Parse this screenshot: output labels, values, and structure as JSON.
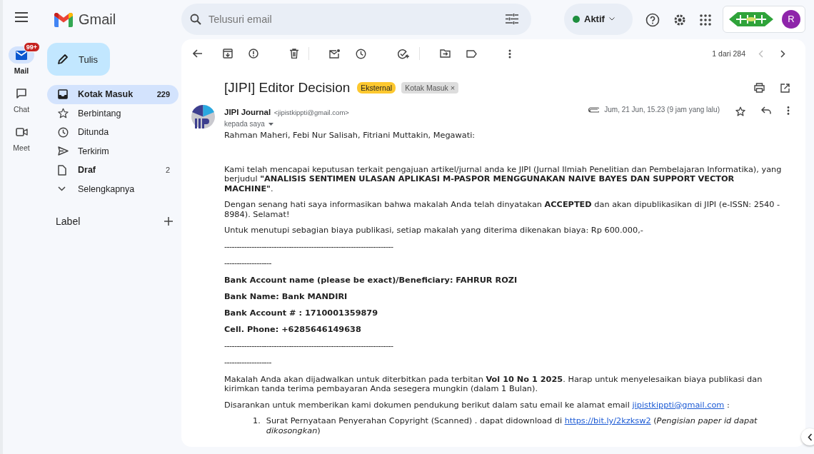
{
  "app_rail": [
    {
      "label": "Mail",
      "selected": true,
      "badge": "99+"
    },
    {
      "label": "Chat",
      "selected": false
    },
    {
      "label": "Meet",
      "selected": false
    }
  ],
  "brand": "Gmail",
  "compose": "Tulis",
  "folders": [
    {
      "label": "Kotak Masuk",
      "count": "229",
      "selected": true,
      "unread": true
    },
    {
      "label": "Berbintang",
      "selected": false,
      "unread": false
    },
    {
      "label": "Ditunda",
      "selected": false,
      "unread": false
    },
    {
      "label": "Terkirim",
      "selected": false,
      "unread": false
    },
    {
      "label": "Draf",
      "count": "2",
      "selected": false,
      "unread": true
    },
    {
      "label": "Selengkapnya",
      "selected": false,
      "unread": false
    }
  ],
  "labels_heading": "Label",
  "search": {
    "placeholder": "Telusuri email"
  },
  "status": {
    "label": "Aktif",
    "color": "#1e8e3e"
  },
  "account": {
    "initial": "R"
  },
  "pagination": "1 dari 284",
  "subject": "[JIPI] Editor Decision",
  "tags": [
    {
      "label": "Eksternal",
      "kind": "external"
    },
    {
      "label": "Kotak Masuk",
      "kind": "folder",
      "close": "×"
    }
  ],
  "message": {
    "sender": "JIPI Journal",
    "address": "<jipistkippti@gmail.com>",
    "to": "kepada saya",
    "date": "Jum, 21 Jun, 15.23 (9 jam yang lalu)",
    "body": [
      {
        "kind": "greeting",
        "text": "Rahman Maheri, Febi Nur Salisah, Fitriani Muttakin, Megawati:"
      },
      {
        "kind": "text",
        "text": "Kami telah mencapai keputusan terkait pengajuan artikel/jurnal anda ke JIPI (Jurnal Ilmiah Penelitian dan Pembelajaran Informatika), yang berjudul **\"ANALISIS SENTIMEN ULASAN APLIKASI M-PASPOR MENGGUNAKAN NAIVE BAYES DAN SUPPORT VECTOR MACHINE\"**."
      },
      {
        "kind": "text",
        "text": "Dengan senang hati saya informasikan bahwa makalah Anda telah dinyatakan **ACCEPTED** dan akan dipublikasikan di JIPI (e-ISSN: 2540 - 8984). Selamat!"
      },
      {
        "kind": "text",
        "text": "Untuk menutupi sebagian biaya publikasi, setiap makalah yang diterima dikenakan biaya: Rp 600.000,-"
      },
      {
        "kind": "rule",
        "text": "--------------------------------------------------------------------"
      },
      {
        "kind": "rule",
        "text": "-------------------"
      },
      {
        "kind": "bold",
        "text": "Bank Account name (please be exact)/Beneficiary: FAHRUR ROZI"
      },
      {
        "kind": "bold",
        "text": "Bank Name: Bank MANDIRI"
      },
      {
        "kind": "bold",
        "text": "Bank Account # : 1710001359879"
      },
      {
        "kind": "bold",
        "text": "Cell. Phone: +6285646149638"
      },
      {
        "kind": "rule",
        "text": "--------------------------------------------------------------------"
      },
      {
        "kind": "rule",
        "text": "-------------------"
      },
      {
        "kind": "text",
        "text": "Makalah Anda akan dijadwalkan untuk diterbitkan pada terbitan **Vol 10 No 1 2025**. Harap untuk menyelesaikan biaya publikasi dan kirimkan tanda terima pembayaran Anda sesegera mungkin (dalam 1 Bulan)."
      },
      {
        "kind": "text",
        "text": "Disarankan untuk memberikan kami dokumen pendukung berikut dalam satu email ke alamat email ",
        "link": "jipistkippti@gmail.com",
        "tail": "  :"
      },
      {
        "kind": "list_item",
        "number": "1.",
        "text": "Surat Pernyataan Penyerahan Copyright (Scanned) . dapat didownload di ",
        "link": "https://bit.ly/2kzksw2",
        "tail": " (*Pengisian paper id dapat dikosongkan*)"
      }
    ]
  }
}
